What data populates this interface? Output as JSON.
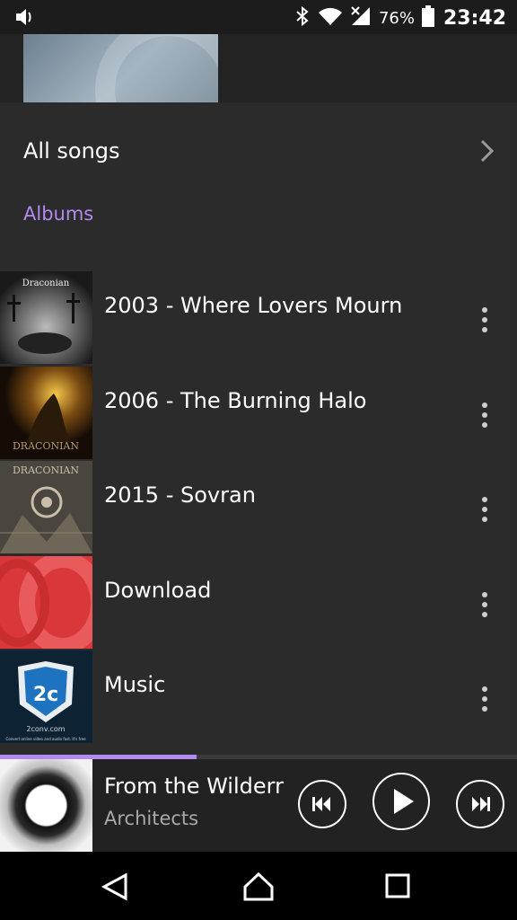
{
  "status_bar": {
    "battery_percent": "76%",
    "time": "23:42",
    "icons": [
      "volume-icon",
      "bluetooth-icon",
      "wifi-icon",
      "cell-signal-icon",
      "battery-icon"
    ]
  },
  "library": {
    "all_songs_label": "All songs",
    "albums_section_label": "Albums",
    "albums": [
      {
        "title": "2003 - Where Lovers Mourn"
      },
      {
        "title": "2006 - The Burning Halo"
      },
      {
        "title": "2015 - Sovran"
      },
      {
        "title": "Download"
      },
      {
        "title": "Music"
      }
    ]
  },
  "artwork_text": {
    "album1": "Draconian",
    "album2_band": "DRACONIAN",
    "album3_band": "DRACONIAN",
    "album5_logo": "2c",
    "album5_domain": "2conv.com",
    "album5_tagline": "Convert online video and audio fast. It's free"
  },
  "now_playing": {
    "title": "From the Wilderness",
    "artist": "Architects",
    "progress_fraction": 0.38
  },
  "colors": {
    "accent": "#b08bf0",
    "background": "#2b2b2b",
    "status_bar": "#1c1c1c",
    "nav_bar": "#000000"
  }
}
